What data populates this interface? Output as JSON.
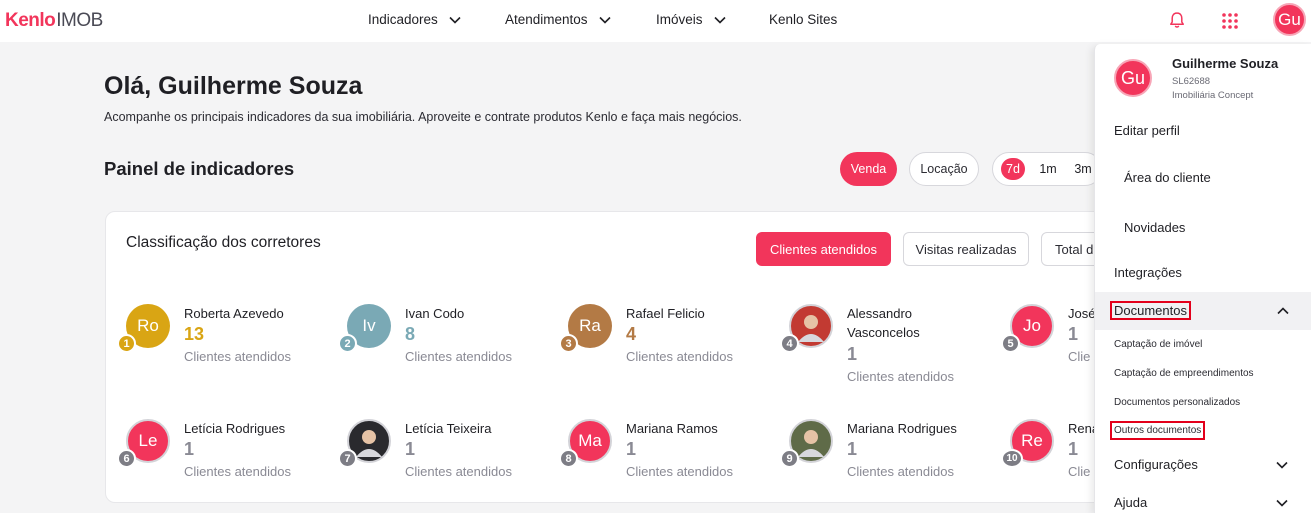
{
  "brand": {
    "logo_primary": "Kenlo",
    "logo_secondary": "IMOB",
    "accent": "#f2355b"
  },
  "nav": {
    "items": [
      {
        "label": "Indicadores",
        "has_dropdown": true
      },
      {
        "label": "Atendimentos",
        "has_dropdown": true
      },
      {
        "label": "Imóveis",
        "has_dropdown": true
      },
      {
        "label": "Kenlo Sites",
        "has_dropdown": false
      }
    ],
    "icons": [
      "bell-icon",
      "apps-grid-icon"
    ],
    "user_initials": "Gu"
  },
  "header": {
    "greeting": "Olá, Guilherme Souza",
    "subtitle": "Acompanhe os principais indicadores da sua imobiliária. Aproveite e contrate produtos Kenlo e faça mais negócios."
  },
  "panel": {
    "title": "Painel de indicadores",
    "modes": [
      {
        "label": "Venda",
        "active": true
      },
      {
        "label": "Locação",
        "active": false
      }
    ],
    "periods": [
      {
        "label": "7d",
        "active": true
      },
      {
        "label": "1m",
        "active": false
      },
      {
        "label": "3m",
        "active": false
      }
    ]
  },
  "ranking": {
    "title": "Classificação dos corretores",
    "tabs": [
      {
        "label": "Clientes atendidos",
        "active": true
      },
      {
        "label": "Visitas realizadas",
        "active": false
      },
      {
        "label": "Total d",
        "active": false
      }
    ],
    "brokers": [
      {
        "rank": "1",
        "initials": "Ro",
        "name": "Roberta Azevedo",
        "count": "13",
        "label": "Clientes atendidos",
        "avatar_color": "#d9a514",
        "rank_color": "#d9a514",
        "count_color": "#d9a514"
      },
      {
        "rank": "2",
        "initials": "Iv",
        "name": "Ivan Codo",
        "count": "8",
        "label": "Clientes atendidos",
        "avatar_color": "#7aa9b5",
        "rank_color": "#7aa9b5",
        "count_color": "#7aa9b5"
      },
      {
        "rank": "3",
        "initials": "Ra",
        "name": "Rafael Felicio",
        "count": "4",
        "label": "Clientes atendidos",
        "avatar_color": "#b37a45",
        "rank_color": "#b37a45",
        "count_color": "#b37a45"
      },
      {
        "rank": "4",
        "initials": "",
        "photo": true,
        "name": "Alessandro Vasconcelos",
        "count": "1",
        "label": "Clientes atendidos",
        "avatar_color": "#c23a32",
        "rank_color": "#7d7d85",
        "count_color": "#8a8a94"
      },
      {
        "rank": "5",
        "initials": "Jo",
        "name": "José",
        "count": "1",
        "label": "Clie",
        "avatar_color": "#f2355b",
        "rank_color": "#7d7d85",
        "count_color": "#8a8a94"
      },
      {
        "rank": "6",
        "initials": "Le",
        "name": "Letícia Rodrigues",
        "count": "1",
        "label": "Clientes atendidos",
        "avatar_color": "#f2355b",
        "rank_color": "#7d7d85",
        "count_color": "#8a8a94"
      },
      {
        "rank": "7",
        "initials": "",
        "photo": true,
        "name": "Letícia Teixeira",
        "count": "1",
        "label": "Clientes atendidos",
        "avatar_color": "#2a2a2e",
        "rank_color": "#7d7d85",
        "count_color": "#8a8a94"
      },
      {
        "rank": "8",
        "initials": "Ma",
        "name": "Mariana Ramos",
        "count": "1",
        "label": "Clientes atendidos",
        "avatar_color": "#f2355b",
        "rank_color": "#7d7d85",
        "count_color": "#8a8a94"
      },
      {
        "rank": "9",
        "initials": "",
        "photo": true,
        "name": "Mariana Rodrigues",
        "count": "1",
        "label": "Clientes atendidos",
        "avatar_color": "#5f6b48",
        "rank_color": "#7d7d85",
        "count_color": "#8a8a94"
      },
      {
        "rank": "10",
        "initials": "Re",
        "name": "Rena",
        "count": "1",
        "label": "Clie",
        "avatar_color": "#f2355b",
        "rank_color": "#7d7d85",
        "count_color": "#8a8a94"
      }
    ]
  },
  "user_menu": {
    "initials": "Gu",
    "name": "Guilherme Souza",
    "code": "SL62688",
    "company": "Imobiliária Concept",
    "items": {
      "edit_profile": "Editar perfil",
      "client_area": "Área do cliente",
      "news": "Novidades",
      "integrations": "Integrações",
      "documents": "Documentos",
      "settings": "Configurações",
      "help": "Ajuda"
    },
    "documents_sub": [
      "Captação de imóvel",
      "Captação de empreendimentos",
      "Documentos personalizados",
      "Outros documentos"
    ]
  }
}
